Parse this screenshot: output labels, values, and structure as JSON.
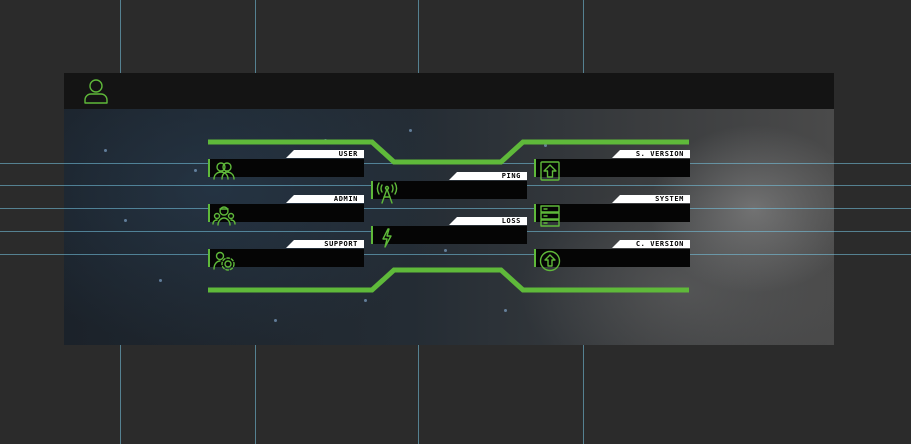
{
  "hud": {
    "panels": {
      "user": {
        "label": "USER",
        "value": ""
      },
      "admin": {
        "label": "ADMIN",
        "value": ""
      },
      "support": {
        "label": "SUPPORT",
        "value": ""
      },
      "ping": {
        "label": "PING",
        "value": ""
      },
      "loss": {
        "label": "LOSS",
        "value": ""
      },
      "s_version": {
        "label": "S. VERSION",
        "value": ""
      },
      "system": {
        "label": "SYSTEM",
        "value": ""
      },
      "c_version": {
        "label": "C. VERSION",
        "value": ""
      }
    }
  },
  "colors": {
    "accent": "#5fb93a",
    "label_bg": "#ffffff",
    "panel_bg": "#050505",
    "topbar": "#141414"
  },
  "icons": [
    "user-icon",
    "users-icon",
    "admin-icon",
    "support-icon",
    "antenna-icon",
    "bolt-icon",
    "upload-icon",
    "server-icon",
    "arrow-up-circle-icon"
  ]
}
